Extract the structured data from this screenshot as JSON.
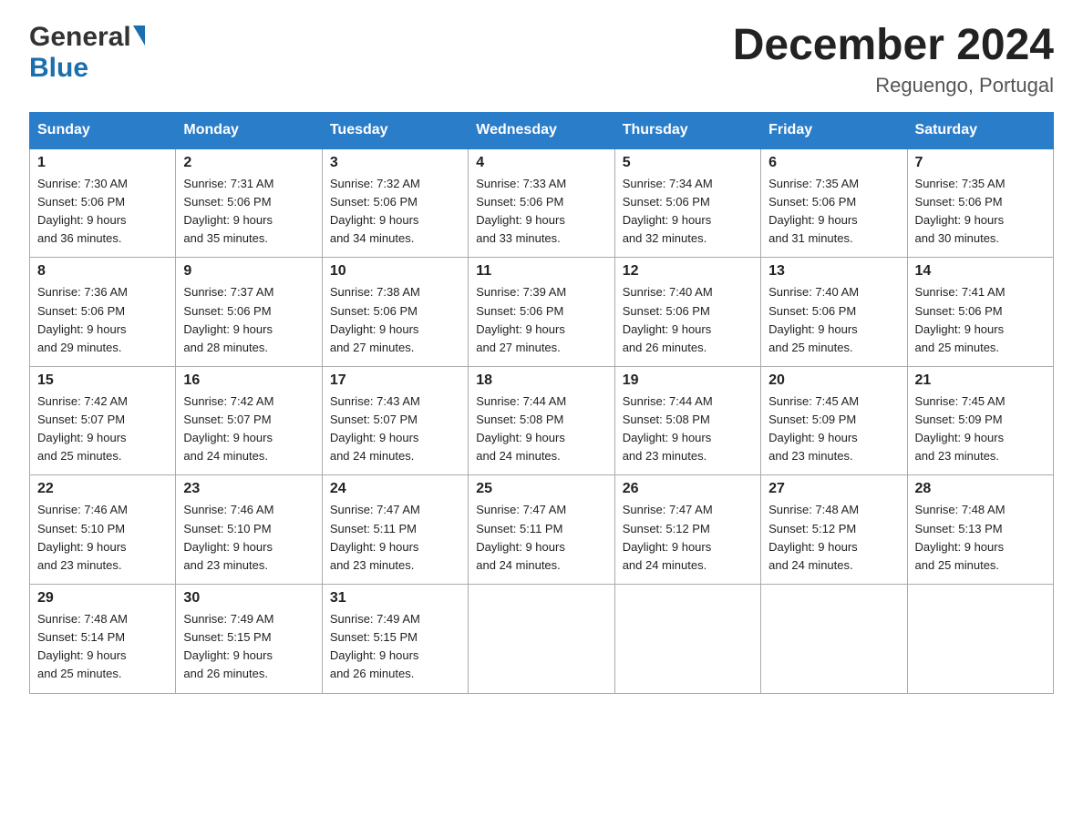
{
  "header": {
    "logo_general": "General",
    "logo_blue": "Blue",
    "title": "December 2024",
    "subtitle": "Reguengo, Portugal"
  },
  "weekdays": [
    "Sunday",
    "Monday",
    "Tuesday",
    "Wednesday",
    "Thursday",
    "Friday",
    "Saturday"
  ],
  "weeks": [
    [
      {
        "day": "1",
        "sunrise": "7:30 AM",
        "sunset": "5:06 PM",
        "daylight": "9 hours and 36 minutes."
      },
      {
        "day": "2",
        "sunrise": "7:31 AM",
        "sunset": "5:06 PM",
        "daylight": "9 hours and 35 minutes."
      },
      {
        "day": "3",
        "sunrise": "7:32 AM",
        "sunset": "5:06 PM",
        "daylight": "9 hours and 34 minutes."
      },
      {
        "day": "4",
        "sunrise": "7:33 AM",
        "sunset": "5:06 PM",
        "daylight": "9 hours and 33 minutes."
      },
      {
        "day": "5",
        "sunrise": "7:34 AM",
        "sunset": "5:06 PM",
        "daylight": "9 hours and 32 minutes."
      },
      {
        "day": "6",
        "sunrise": "7:35 AM",
        "sunset": "5:06 PM",
        "daylight": "9 hours and 31 minutes."
      },
      {
        "day": "7",
        "sunrise": "7:35 AM",
        "sunset": "5:06 PM",
        "daylight": "9 hours and 30 minutes."
      }
    ],
    [
      {
        "day": "8",
        "sunrise": "7:36 AM",
        "sunset": "5:06 PM",
        "daylight": "9 hours and 29 minutes."
      },
      {
        "day": "9",
        "sunrise": "7:37 AM",
        "sunset": "5:06 PM",
        "daylight": "9 hours and 28 minutes."
      },
      {
        "day": "10",
        "sunrise": "7:38 AM",
        "sunset": "5:06 PM",
        "daylight": "9 hours and 27 minutes."
      },
      {
        "day": "11",
        "sunrise": "7:39 AM",
        "sunset": "5:06 PM",
        "daylight": "9 hours and 27 minutes."
      },
      {
        "day": "12",
        "sunrise": "7:40 AM",
        "sunset": "5:06 PM",
        "daylight": "9 hours and 26 minutes."
      },
      {
        "day": "13",
        "sunrise": "7:40 AM",
        "sunset": "5:06 PM",
        "daylight": "9 hours and 25 minutes."
      },
      {
        "day": "14",
        "sunrise": "7:41 AM",
        "sunset": "5:06 PM",
        "daylight": "9 hours and 25 minutes."
      }
    ],
    [
      {
        "day": "15",
        "sunrise": "7:42 AM",
        "sunset": "5:07 PM",
        "daylight": "9 hours and 25 minutes."
      },
      {
        "day": "16",
        "sunrise": "7:42 AM",
        "sunset": "5:07 PM",
        "daylight": "9 hours and 24 minutes."
      },
      {
        "day": "17",
        "sunrise": "7:43 AM",
        "sunset": "5:07 PM",
        "daylight": "9 hours and 24 minutes."
      },
      {
        "day": "18",
        "sunrise": "7:44 AM",
        "sunset": "5:08 PM",
        "daylight": "9 hours and 24 minutes."
      },
      {
        "day": "19",
        "sunrise": "7:44 AM",
        "sunset": "5:08 PM",
        "daylight": "9 hours and 23 minutes."
      },
      {
        "day": "20",
        "sunrise": "7:45 AM",
        "sunset": "5:09 PM",
        "daylight": "9 hours and 23 minutes."
      },
      {
        "day": "21",
        "sunrise": "7:45 AM",
        "sunset": "5:09 PM",
        "daylight": "9 hours and 23 minutes."
      }
    ],
    [
      {
        "day": "22",
        "sunrise": "7:46 AM",
        "sunset": "5:10 PM",
        "daylight": "9 hours and 23 minutes."
      },
      {
        "day": "23",
        "sunrise": "7:46 AM",
        "sunset": "5:10 PM",
        "daylight": "9 hours and 23 minutes."
      },
      {
        "day": "24",
        "sunrise": "7:47 AM",
        "sunset": "5:11 PM",
        "daylight": "9 hours and 23 minutes."
      },
      {
        "day": "25",
        "sunrise": "7:47 AM",
        "sunset": "5:11 PM",
        "daylight": "9 hours and 24 minutes."
      },
      {
        "day": "26",
        "sunrise": "7:47 AM",
        "sunset": "5:12 PM",
        "daylight": "9 hours and 24 minutes."
      },
      {
        "day": "27",
        "sunrise": "7:48 AM",
        "sunset": "5:12 PM",
        "daylight": "9 hours and 24 minutes."
      },
      {
        "day": "28",
        "sunrise": "7:48 AM",
        "sunset": "5:13 PM",
        "daylight": "9 hours and 25 minutes."
      }
    ],
    [
      {
        "day": "29",
        "sunrise": "7:48 AM",
        "sunset": "5:14 PM",
        "daylight": "9 hours and 25 minutes."
      },
      {
        "day": "30",
        "sunrise": "7:49 AM",
        "sunset": "5:15 PM",
        "daylight": "9 hours and 26 minutes."
      },
      {
        "day": "31",
        "sunrise": "7:49 AM",
        "sunset": "5:15 PM",
        "daylight": "9 hours and 26 minutes."
      },
      null,
      null,
      null,
      null
    ]
  ],
  "labels": {
    "sunrise": "Sunrise:",
    "sunset": "Sunset:",
    "daylight": "Daylight:"
  }
}
